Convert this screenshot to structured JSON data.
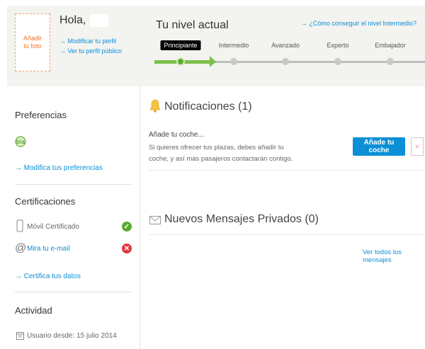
{
  "header": {
    "photo_label": "Añadir tu foto",
    "greeting": "Hola,",
    "edit_profile": "→ Modificar tu perfil",
    "view_profile": "→ Ver tu perfil público",
    "level_title": "Tu nivel actual",
    "level_link": "→ ¿Cómo conseguir el nivel Intermedio?",
    "levels": [
      "Principiante",
      "Intermedio",
      "Avanzado",
      "Experto",
      "Embajador"
    ],
    "current_level": "Principiante"
  },
  "sidebar": {
    "preferences_title": "Preferencias",
    "preferences_link": "→ Modifica tus preferencias",
    "certifications_title": "Certificaciones",
    "mobile_label": "Móvil Certificado",
    "email_link": "Mira tu e-mail",
    "certify_link": "→ Certifica tus datos",
    "activity_title": "Actividad",
    "member_since": "Usuario desde: 15 julio 2014"
  },
  "main": {
    "notifications_title": "Notificaciones (1)",
    "notification_heading": "Añade tu coche...",
    "notification_body": "Si quieres ofrecer tus plazas, debes añadir tu coche, y así más pasajeros contactarán contigo.",
    "add_car_button": "Añade tu coche",
    "close_glyph": "×",
    "messages_title": "Nuevos Mensajes Privados (0)",
    "view_all_link": "Ver todos los mensajes"
  },
  "colors": {
    "accent_blue": "#0b8fd6",
    "green": "#7cc04b",
    "orange": "#f07020",
    "red": "#e0393e"
  }
}
